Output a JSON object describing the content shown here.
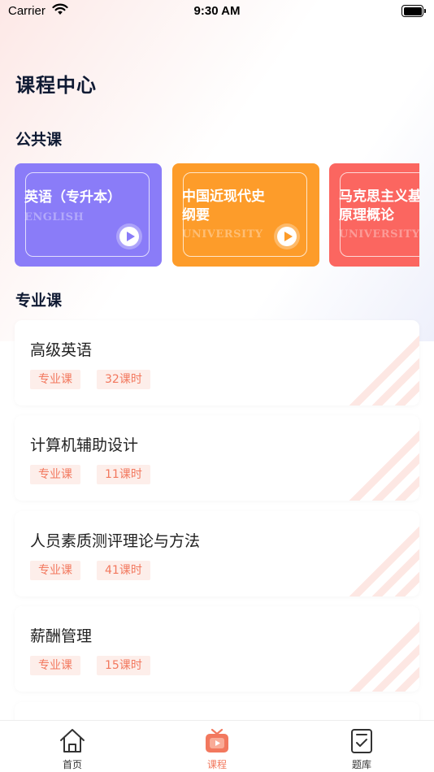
{
  "status_bar": {
    "carrier": "Carrier",
    "time": "9:30 AM"
  },
  "page": {
    "title": "课程中心"
  },
  "sections": {
    "public": "公共课",
    "major": "专业课"
  },
  "public_courses": [
    {
      "title_line1": "英语（专升本）",
      "title_line2": "",
      "subtitle": "ENGLISH",
      "color": "#8a7cf8"
    },
    {
      "title_line1": "中国近现代史",
      "title_line2": "纲要",
      "subtitle": "UNIVERSITY",
      "color": "#fd9c2a"
    },
    {
      "title_line1": "马克思主义基",
      "title_line2": "原理概论",
      "subtitle": "UNIVERSITY",
      "color": "#fb6660"
    }
  ],
  "major_courses": [
    {
      "title": "高级英语",
      "tag": "专业课",
      "hours": "32课时"
    },
    {
      "title": "计算机辅助设计",
      "tag": "专业课",
      "hours": "11课时"
    },
    {
      "title": "人员素质测评理论与方法",
      "tag": "专业课",
      "hours": "41课时"
    },
    {
      "title": "薪酬管理",
      "tag": "专业课",
      "hours": "15课时"
    },
    {
      "title": "",
      "tag": "",
      "hours": ""
    }
  ],
  "tabbar": {
    "active": "course",
    "items": [
      {
        "label": "首页",
        "icon": "home-icon"
      },
      {
        "label": "课程",
        "icon": "tv-play-icon"
      },
      {
        "label": "题库",
        "icon": "checklist-icon"
      }
    ]
  },
  "colors": {
    "accent": "#f2785e",
    "tag_bg": "#fdeeea",
    "title": "#0f1a33"
  }
}
